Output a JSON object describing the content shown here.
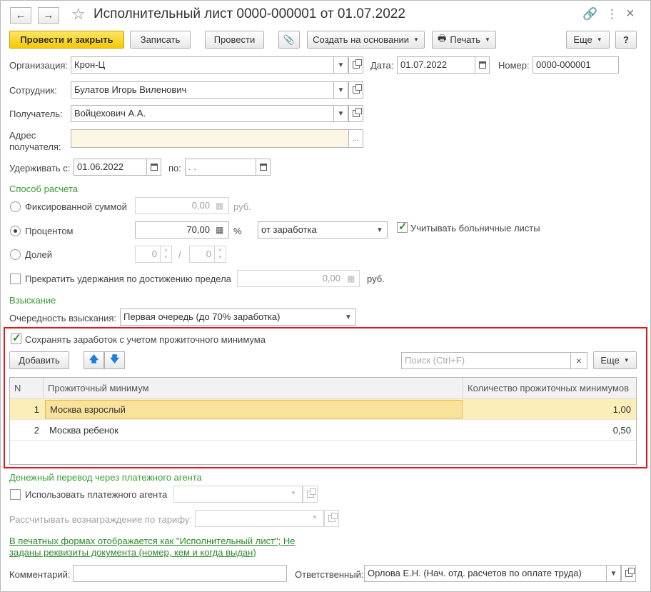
{
  "window": {
    "title": "Исполнительный лист 0000-000001 от 01.07.2022",
    "back_icon": "←",
    "forward_icon": "→",
    "link_icon": "🔗",
    "more_icon": "⋮",
    "close_icon": "×"
  },
  "toolbar": {
    "post_close": "Провести и закрыть",
    "save": "Записать",
    "post": "Провести",
    "attach_icon": "📎",
    "create_based": "Создать на основании",
    "print": "Печать",
    "more": "Еще",
    "help": "?"
  },
  "header": {
    "org_label": "Организация:",
    "org_value": "Крон-Ц",
    "date_label": "Дата:",
    "date_value": "01.07.2022",
    "number_label": "Номер:",
    "number_value": "0000-000001",
    "employee_label": "Сотрудник:",
    "employee_value": "Булатов Игорь Виленович",
    "recipient_label": "Получатель:",
    "recipient_value": "Войцехович А.А.",
    "address_label": "Адрес получателя:",
    "address_value": "",
    "withhold_from_label": "Удерживать с:",
    "withhold_from_value": "01.06.2022",
    "withhold_to_label": "по:",
    "withhold_to_value": " .  .",
    "ellipsis": "..."
  },
  "calc": {
    "section_title": "Способ расчета",
    "fixed_label": "Фиксированной суммой",
    "fixed_value": "0,00",
    "fixed_unit": "руб.",
    "percent_label": "Процентом",
    "percent_value": "70,00",
    "percent_unit": "%",
    "percent_base": "от заработка",
    "sick_leave_label": "Учитывать больничные листы",
    "share_label": "Долей",
    "share_num": "0",
    "share_sep": "/",
    "share_den": "0",
    "stop_label": "Прекратить удержания по достижению предела",
    "stop_value": "0,00",
    "stop_unit": "руб."
  },
  "recovery": {
    "section_title": "Взыскание",
    "order_label": "Очередность взыскания:",
    "order_value": "Первая очередь (до 70% заработка)"
  },
  "subsistence": {
    "keep_label": "Сохранять заработок с учетом прожиточного минимума",
    "add_button": "Добавить",
    "up_icon": "🡅",
    "down_icon": "🡇",
    "search_placeholder": "Поиск (Ctrl+F)",
    "search_clear": "×",
    "more": "Еще",
    "columns": [
      "N",
      "Прожиточный минимум",
      "Количество прожиточных минимумов"
    ],
    "rows": [
      {
        "n": "1",
        "name": "Москва взрослый",
        "qty": "1,00"
      },
      {
        "n": "2",
        "name": "Москва ребенок",
        "qty": "0,50"
      }
    ]
  },
  "transfer": {
    "section_title": "Денежный перевод через платежного агента",
    "use_agent_label": "Использовать платежного агента",
    "tariff_label": "Рассчитывать вознаграждение по тарифу:"
  },
  "footer": {
    "link_line1": "В печатных формах отображается как \"Исполнительный лист\"; Не",
    "link_line2": "заданы реквизиты документа (номер, кем и когда выдан)",
    "comment_label": "Комментарий:",
    "comment_value": "",
    "responsible_label": "Ответственный:",
    "responsible_value": "Орлова Е.Н. (Нач. отд. расчетов по оплате труда)"
  }
}
